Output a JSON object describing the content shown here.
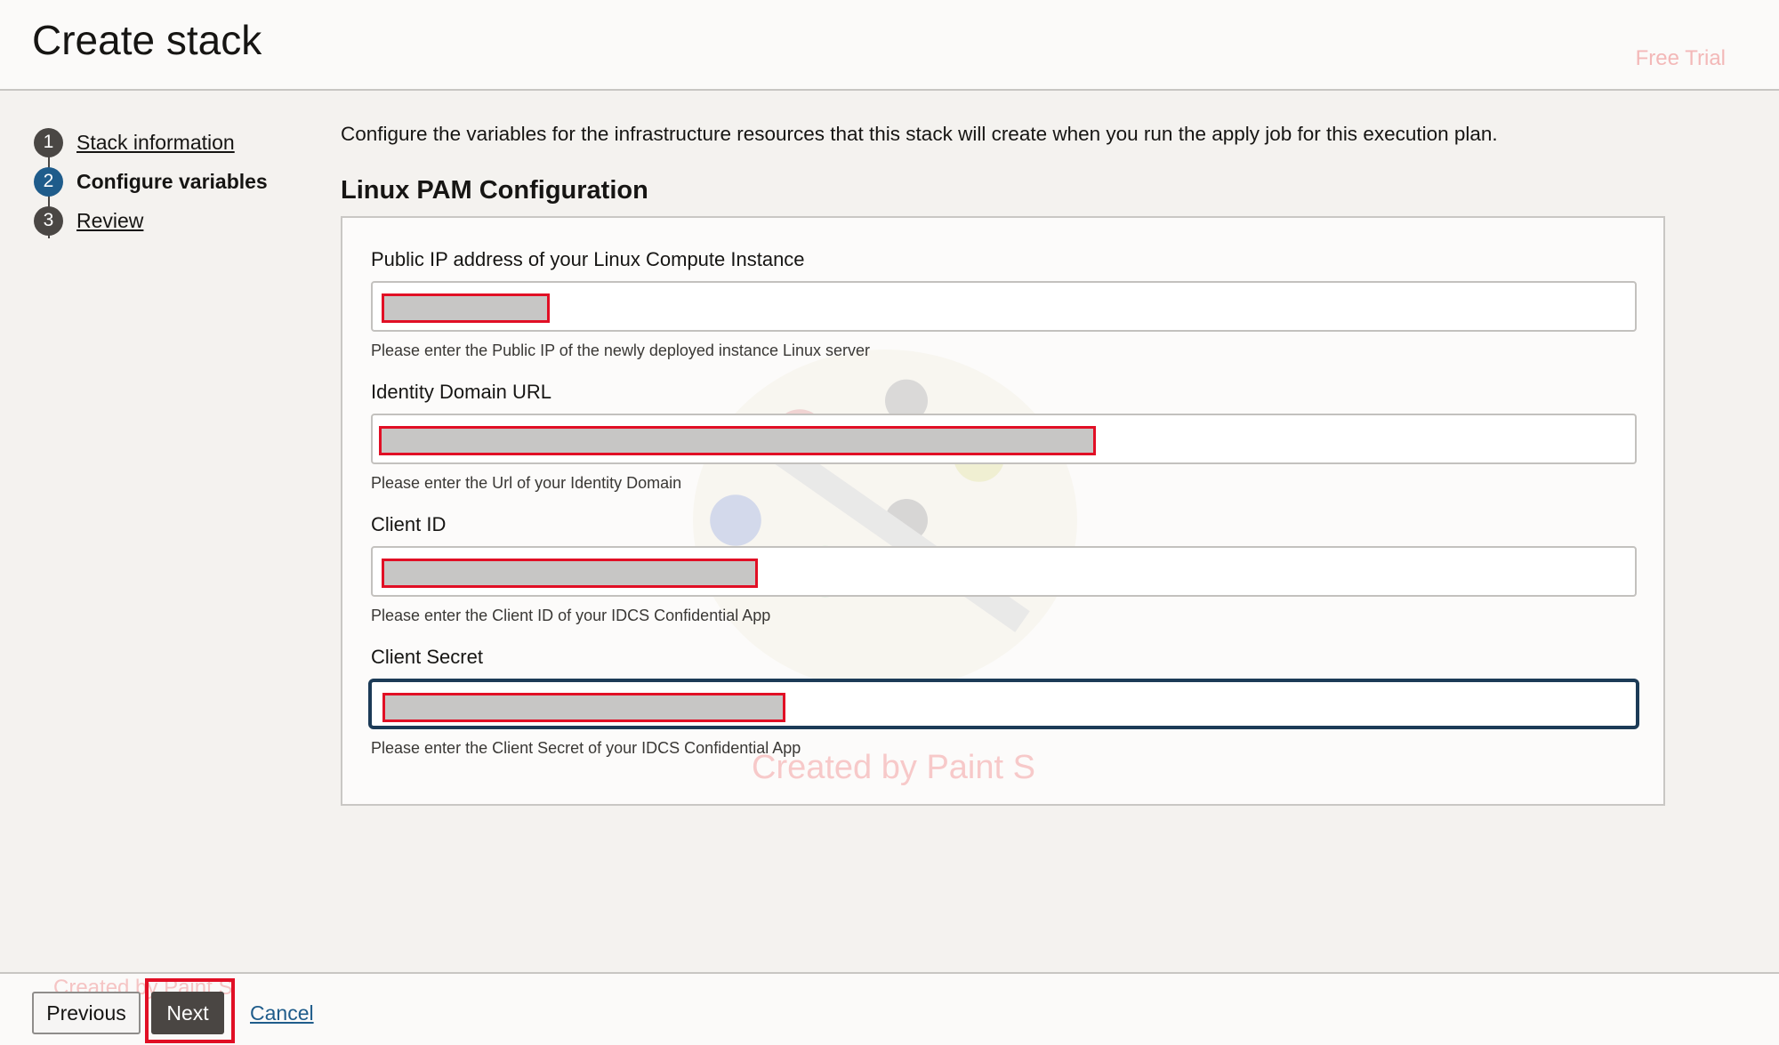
{
  "header": {
    "title": "Create stack",
    "trial_label": "Free Trial"
  },
  "steps": [
    {
      "number": "1",
      "label": "Stack information",
      "active": false
    },
    {
      "number": "2",
      "label": "Configure variables",
      "active": true
    },
    {
      "number": "3",
      "label": "Review",
      "active": false
    }
  ],
  "main": {
    "intro": "Configure the variables for the infrastructure resources that this stack will create when you run the apply job for this execution plan.",
    "section_title": "Linux PAM Configuration",
    "fields": [
      {
        "label": "Public IP address of your Linux Compute Instance",
        "help": "Please enter the Public IP of the newly deployed instance Linux server"
      },
      {
        "label": "Identity Domain URL",
        "help": "Please enter the Url of your Identity Domain"
      },
      {
        "label": "Client ID",
        "help": "Please enter the Client ID of your IDCS Confidential App"
      },
      {
        "label": "Client Secret",
        "help": "Please enter the Client Secret of your IDCS Confidential App"
      }
    ],
    "watermark": "Created by Paint S"
  },
  "footer": {
    "previous_label": "Previous",
    "next_label": "Next",
    "cancel_label": "Cancel",
    "watermark": "Created by Paint S"
  },
  "colors": {
    "accent": "#1f5c8b",
    "highlight": "#e10f25",
    "step_bg": "#4a4744"
  }
}
